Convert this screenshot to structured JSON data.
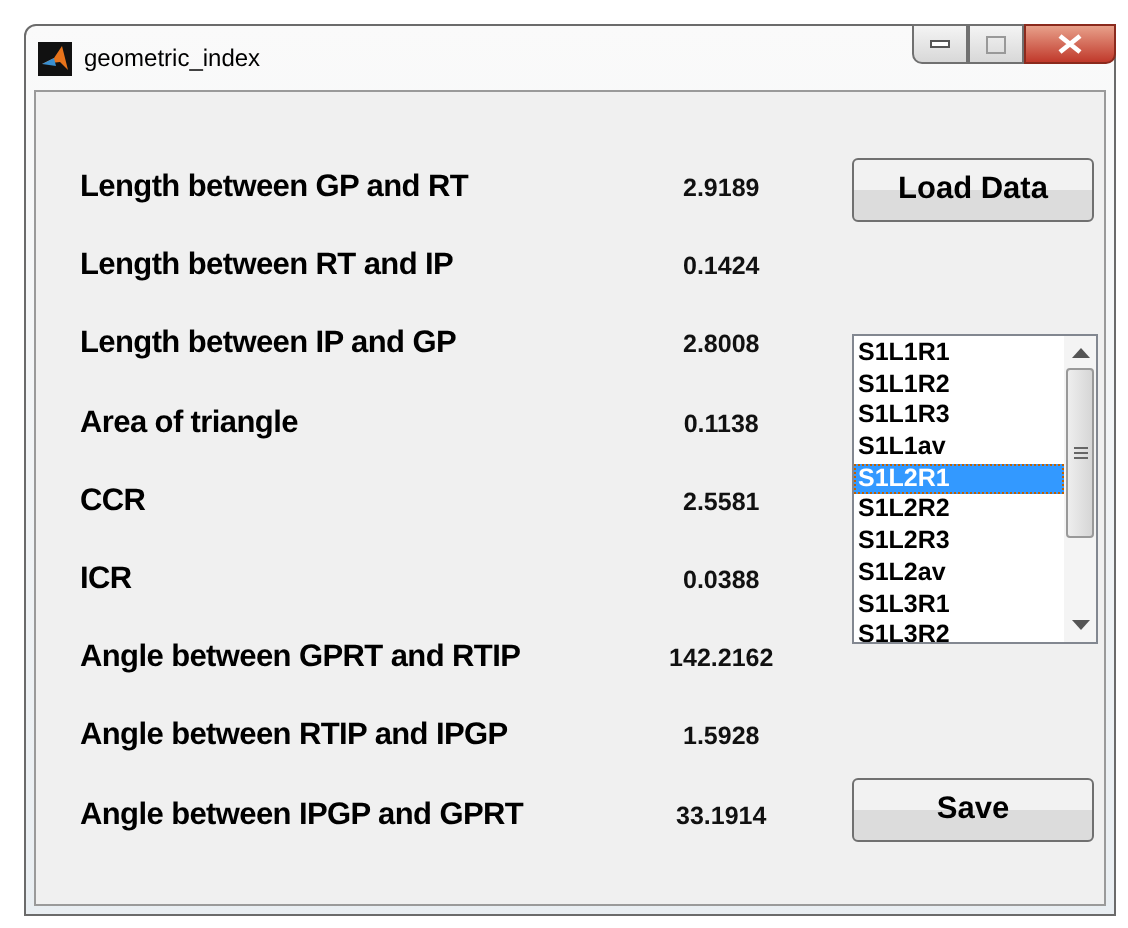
{
  "window": {
    "title": "geometric_index"
  },
  "measurements": [
    {
      "label": "Length between GP and RT",
      "value": "2.9189"
    },
    {
      "label": "Length between  RT and IP",
      "value": "0.1424"
    },
    {
      "label": "Length between IP and GP",
      "value": "2.8008"
    },
    {
      "label": "Area of triangle",
      "value": "0.1138"
    },
    {
      "label": "CCR",
      "value": "2.5581"
    },
    {
      "label": "ICR",
      "value": "0.0388"
    },
    {
      "label": "Angle between GPRT and RTIP",
      "value": "142.2162"
    },
    {
      "label": "Angle between  RTIP and IPGP",
      "value": "1.5928"
    },
    {
      "label": "Angle between IPGP and GPRT",
      "value": "33.1914"
    }
  ],
  "buttons": {
    "load": "Load Data",
    "save": "Save"
  },
  "listbox": {
    "items": [
      {
        "label": "S1L1R1",
        "selected": false
      },
      {
        "label": "S1L1R2",
        "selected": false
      },
      {
        "label": "S1L1R3",
        "selected": false
      },
      {
        "label": "S1L1av",
        "selected": false
      },
      {
        "label": "S1L2R1",
        "selected": true
      },
      {
        "label": "S1L2R2",
        "selected": false
      },
      {
        "label": "S1L2R3",
        "selected": false
      },
      {
        "label": "S1L2av",
        "selected": false
      },
      {
        "label": "S1L3R1",
        "selected": false
      },
      {
        "label": "S1L3R2",
        "selected": false
      }
    ]
  }
}
